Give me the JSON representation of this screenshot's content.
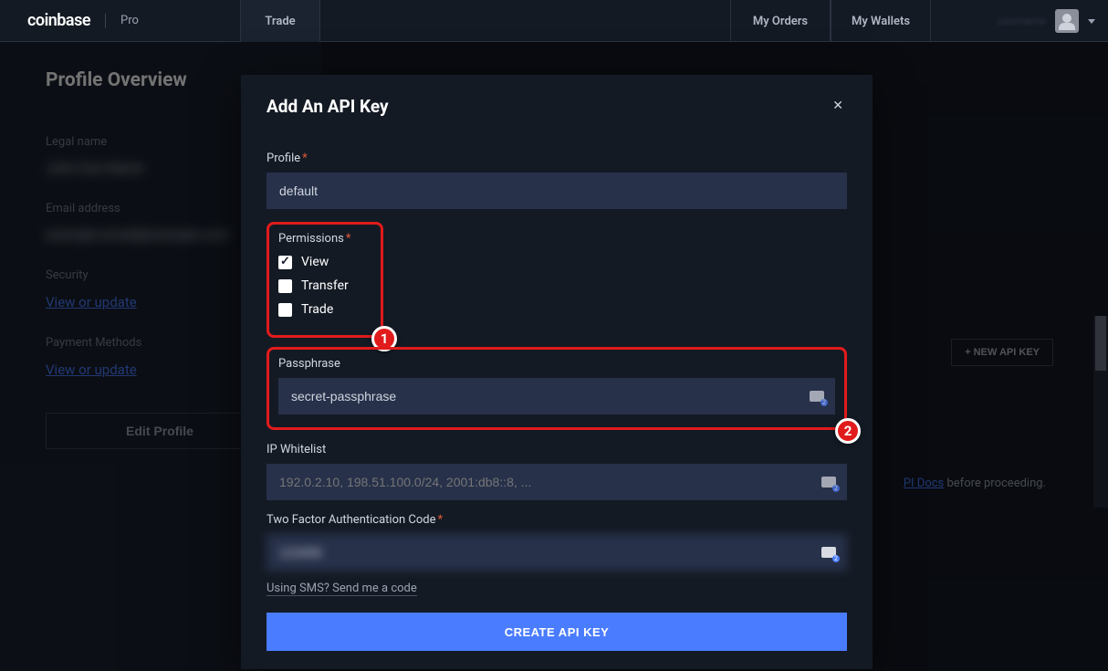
{
  "header": {
    "brand_main": "coinbase",
    "brand_sub": "Pro",
    "nav": {
      "trade": "Trade",
      "my_orders": "My Orders",
      "my_wallets": "My Wallets"
    },
    "username_masked": "username"
  },
  "sidebar": {
    "title": "Profile Overview",
    "fields": {
      "legal_name_label": "Legal name",
      "legal_name_value": "John Doe Name",
      "email_label": "Email address",
      "email_value": "example.email@example.com",
      "security_label": "Security",
      "security_link": "View or update",
      "payment_label": "Payment Methods",
      "payment_link": "View or update"
    },
    "edit_button": "Edit Profile"
  },
  "main": {
    "new_api_key_button": "+ NEW API KEY",
    "api_docs_prefix": "PI Docs",
    "api_docs_suffix": " before proceeding."
  },
  "modal": {
    "title": "Add An API Key",
    "profile_label": "Profile",
    "profile_value": "default",
    "permissions_label": "Permissions",
    "permissions": {
      "view": {
        "label": "View",
        "checked": true
      },
      "transfer": {
        "label": "Transfer",
        "checked": false
      },
      "trade": {
        "label": "Trade",
        "checked": false
      }
    },
    "passphrase_label": "Passphrase",
    "passphrase_value": "secret-passphrase",
    "ip_whitelist_label": "IP Whitelist",
    "ip_whitelist_placeholder": "192.0.2.10, 198.51.100.0/24, 2001:db8::8, ...",
    "tfa_label": "Two Factor Authentication Code",
    "tfa_value": "123456",
    "sms_link": "Using SMS? Send me a code",
    "create_button": "CREATE API KEY"
  },
  "annotations": {
    "1": "1",
    "2": "2"
  }
}
